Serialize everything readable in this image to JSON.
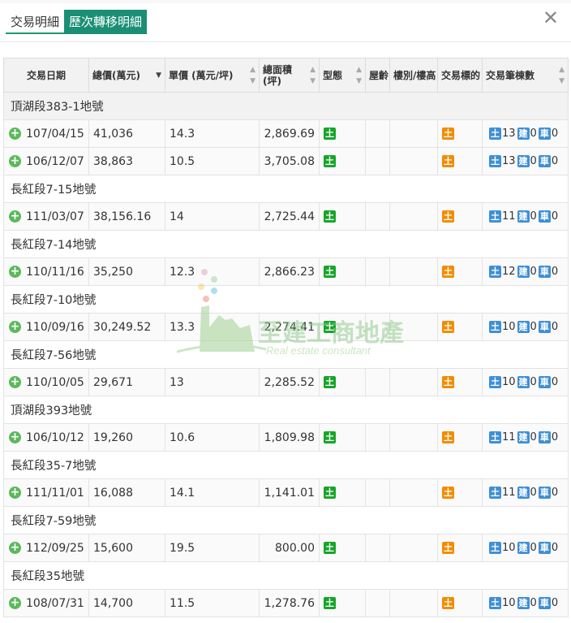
{
  "tabs": [
    {
      "label": "交易明細",
      "active": false
    },
    {
      "label": "歷次轉移明細",
      "active": true
    }
  ],
  "close_icon": "close-icon",
  "table": {
    "headers": [
      "交易日期",
      "總價(萬元)",
      "單價 (萬元/坪)",
      "總面積\n(坪)",
      "型態",
      "屋齡",
      "樓別/樓高",
      "交易標的",
      "交易筆棟數"
    ],
    "groups": [
      {
        "title": "頂湖段383-1地號",
        "rows": [
          {
            "date": "107/04/15",
            "total": "41,036",
            "unit": "14.3",
            "area": "2,869.69",
            "land": "13",
            "bldg": "0",
            "car": "0"
          },
          {
            "date": "106/12/07",
            "total": "38,863",
            "unit": "10.5",
            "area": "3,705.08",
            "land": "13",
            "bldg": "0",
            "car": "0"
          }
        ]
      },
      {
        "title": "長紅段7-15地號",
        "rows": [
          {
            "date": "111/03/07",
            "total": "38,156.16",
            "unit": "14",
            "area": "2,725.44",
            "land": "11",
            "bldg": "0",
            "car": "0"
          }
        ]
      },
      {
        "title": "長紅段7-14地號",
        "rows": [
          {
            "date": "110/11/16",
            "total": "35,250",
            "unit": "12.3",
            "area": "2,866.23",
            "land": "12",
            "bldg": "0",
            "car": "0"
          }
        ]
      },
      {
        "title": "長紅段7-10地號",
        "rows": [
          {
            "date": "110/09/16",
            "total": "30,249.52",
            "unit": "13.3",
            "area": "2,274.41",
            "land": "10",
            "bldg": "0",
            "car": "0"
          }
        ]
      },
      {
        "title": "長紅段7-56地號",
        "rows": [
          {
            "date": "110/10/05",
            "total": "29,671",
            "unit": "13",
            "area": "2,285.52",
            "land": "10",
            "bldg": "0",
            "car": "0"
          }
        ]
      },
      {
        "title": "頂湖段393地號",
        "rows": [
          {
            "date": "106/10/12",
            "total": "19,260",
            "unit": "10.6",
            "area": "1,809.98",
            "land": "11",
            "bldg": "0",
            "car": "0"
          }
        ]
      },
      {
        "title": "長紅段35-7地號",
        "rows": [
          {
            "date": "111/11/01",
            "total": "16,088",
            "unit": "14.1",
            "area": "1,141.01",
            "land": "11",
            "bldg": "0",
            "car": "0"
          }
        ]
      },
      {
        "title": "長紅段7-59地號",
        "rows": [
          {
            "date": "112/09/25",
            "total": "15,600",
            "unit": "19.5",
            "area": "800.00",
            "land": "10",
            "bldg": "0",
            "car": "0"
          }
        ]
      },
      {
        "title": "長紅段35地號",
        "rows": [
          {
            "date": "108/07/31",
            "total": "14,700",
            "unit": "11.5",
            "area": "1,278.76",
            "land": "10",
            "bldg": "0",
            "car": "0"
          }
        ]
      }
    ]
  },
  "badges": {
    "type": "土",
    "target": "土",
    "land": "土",
    "building": "建",
    "parking": "車"
  },
  "watermark": {
    "title": "至建工商地產",
    "subtitle": "Real estate consultant"
  },
  "colors": {
    "accent": "#1a8f75",
    "green_badge": "#17a529",
    "orange_badge": "#f28c00",
    "blue_badge": "#3f8fd6"
  }
}
